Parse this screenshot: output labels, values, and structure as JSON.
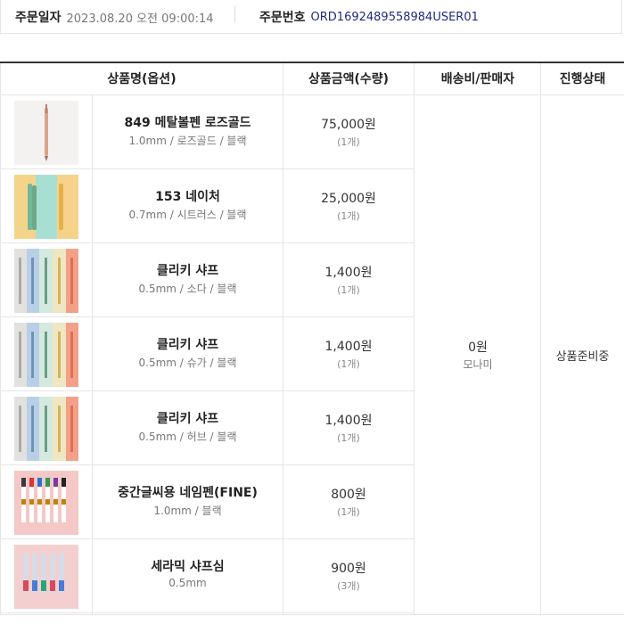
{
  "order": {
    "date_label": "주문일자",
    "date_value": "2023.08.20 오전 09:00:14",
    "number_label": "주문번호",
    "number_value": "ORD1692489558984USER01"
  },
  "table": {
    "headers": {
      "product": "상품명(옵션)",
      "price": "상품금액(수량)",
      "shipping": "배송비/판매자",
      "status": "진행상태"
    },
    "items": [
      {
        "name": "849 메탈볼펜 로즈골드",
        "option": "1.0mm / 로즈골드 / 블랙",
        "price": "75,000원",
        "qty": "(1개)",
        "thumb_icon": "rose-gold-pen-icon"
      },
      {
        "name": "153 네이처",
        "option": "0.7mm / 시트러스 / 블랙",
        "price": "25,000원",
        "qty": "(1개)",
        "thumb_icon": "nature-pens-icon"
      },
      {
        "name": "클리키 샤프",
        "option": "0.5mm / 소다 / 블랙",
        "price": "1,400원",
        "qty": "(1개)",
        "thumb_icon": "clicky-pencil-icon"
      },
      {
        "name": "클리키 샤프",
        "option": "0.5mm / 슈가 / 블랙",
        "price": "1,400원",
        "qty": "(1개)",
        "thumb_icon": "clicky-pencil-icon"
      },
      {
        "name": "클리키 샤프",
        "option": "0.5mm / 허브 / 블랙",
        "price": "1,400원",
        "qty": "(1개)",
        "thumb_icon": "clicky-pencil-icon"
      },
      {
        "name": "중간글씨용 네임펜(FINE)",
        "option": "1.0mm / 블랙",
        "price": "800원",
        "qty": "(1개)",
        "thumb_icon": "name-pen-icon"
      },
      {
        "name": "세라믹 샤프심",
        "option": "0.5mm",
        "price": "900원",
        "qty": "(3개)",
        "thumb_icon": "lead-refill-icon"
      }
    ],
    "shipping_fee": "0원",
    "seller": "모나미",
    "status": "상품준비중"
  }
}
